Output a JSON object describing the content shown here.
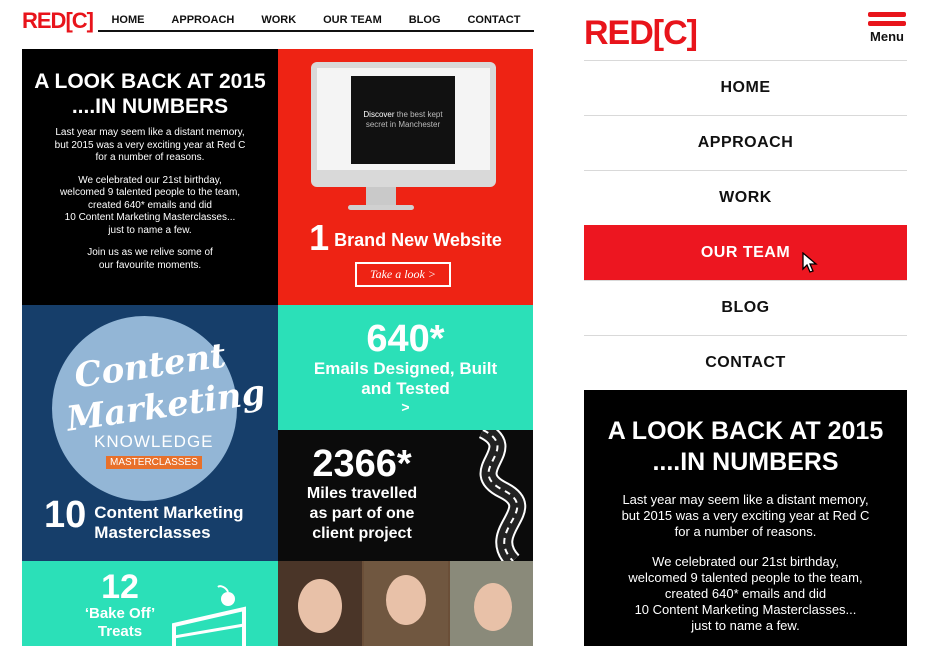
{
  "desktop": {
    "logo": "RED[C]",
    "nav": [
      "HOME",
      "APPROACH",
      "WORK",
      "OUR TEAM",
      "BLOG",
      "CONTACT"
    ],
    "intro": {
      "title_line1": "A LOOK BACK AT 2015",
      "title_line2": "....IN NUMBERS",
      "para1_line1": "Last year may seem like a distant memory,",
      "para1_line2": "but 2015 was a very exciting year at Red C",
      "para1_line3": "for a number of reasons.",
      "para2_line1": "We celebrated our 21st birthday,",
      "para2_line2": "welcomed 9 talented people to the team,",
      "para2_line3": "created 640* emails and did",
      "para2_line4": "10 Content Marketing Masterclasses...",
      "para2_line5": "just to name a few.",
      "para3_line1": "Join us as we relive some of",
      "para3_line2": "our favourite moments."
    },
    "website": {
      "screen_text_a": "Discover",
      "screen_text_b": "the best kept",
      "screen_text_c": "secret in Manchester",
      "number": "1",
      "label": "Brand New Website",
      "button": "Take a look >"
    },
    "masterclass": {
      "badge_line1": "Content",
      "badge_line2": "Marketing",
      "badge_line3": "KNOWLEDGE",
      "badge_line4": "MASTERCLASSES",
      "number": "10",
      "label_line1": "Content Marketing",
      "label_line2": "Masterclasses"
    },
    "emails": {
      "number": "640*",
      "label_line1": "Emails Designed, Built",
      "label_line2": "and Tested",
      "arrow": ">"
    },
    "miles": {
      "number": "2366*",
      "label_line1": "Miles travelled",
      "label_line2": "as part of one",
      "label_line3": "client project"
    },
    "bake": {
      "number": "12",
      "label_line1": "‘Bake Off’",
      "label_line2": "Treats"
    }
  },
  "mobile": {
    "logo": "RED[C]",
    "menu_label": "Menu",
    "nav": [
      "HOME",
      "APPROACH",
      "WORK",
      "OUR TEAM",
      "BLOG",
      "CONTACT"
    ],
    "active_item": "OUR TEAM",
    "intro": {
      "title_line1": "A LOOK BACK AT 2015",
      "title_line2": "....IN NUMBERS",
      "para1_line1": "Last year may seem like a distant memory,",
      "para1_line2": "but 2015 was a very exciting year at Red C",
      "para1_line3": "for a number of reasons.",
      "para2_line1": "We celebrated our 21st birthday,",
      "para2_line2": "welcomed 9 talented people to the team,",
      "para2_line3": "created 640* emails and did",
      "para2_line4": "10 Content Marketing Masterclasses...",
      "para2_line5": "just to name a few."
    }
  },
  "colors": {
    "brand_red": "#e8141b",
    "active_red": "#ed1620",
    "teal": "#2be0b8",
    "navy": "#163e6a",
    "black": "#000000"
  },
  "icons": {
    "menu": "hamburger-icon",
    "cursor": "mouse-pointer-icon",
    "monitor": "desktop-monitor-illustration",
    "road": "winding-road-illustration",
    "cake": "cake-slice-illustration"
  }
}
